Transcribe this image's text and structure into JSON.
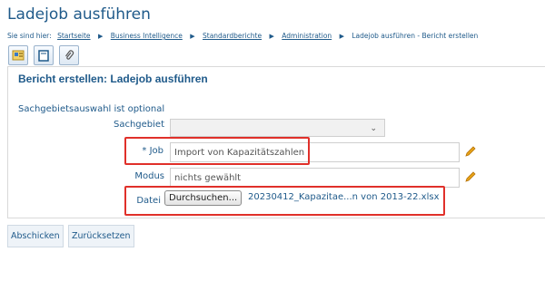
{
  "page": {
    "title": "Ladejob ausführen"
  },
  "breadcrumb": {
    "prefix": "Sie sind hier:",
    "items": [
      "Startseite",
      "Business Intelligence",
      "Standardberichte",
      "Administration"
    ],
    "current": "Ladejob ausführen - Bericht erstellen"
  },
  "toolbar": {
    "icons": [
      "report-icon",
      "document-icon",
      "paperclip-icon"
    ]
  },
  "panel": {
    "title": "Bericht erstellen: Ladejob ausführen",
    "optional_note": "Sachgebietsauswahl ist optional"
  },
  "form": {
    "sachgebiet": {
      "label": "Sachgebiet",
      "value": ""
    },
    "job": {
      "label": "* Job",
      "value": "Import von Kapazitätszahlen"
    },
    "modus": {
      "label": "Modus",
      "value": "nichts gewählt"
    },
    "datei": {
      "label": "Datei",
      "button": "Durchsuchen...",
      "file_name": "20230412_Kapazitae...n von 2013-22.xlsx"
    }
  },
  "actions": {
    "submit": "Abschicken",
    "reset": "Zurücksetzen"
  },
  "colors": {
    "accent": "#1f5a8a",
    "highlight": "#e0302a",
    "edit_icon": "#e8a317"
  }
}
